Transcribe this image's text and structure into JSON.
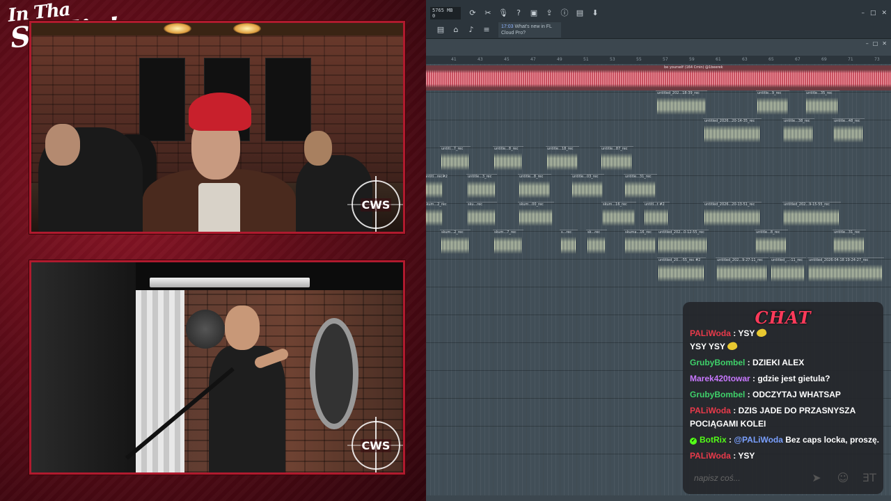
{
  "overlay": {
    "logo_line1": "In Tha",
    "logo_line2": "Studio!",
    "cam_top_watermark": "CWS",
    "cam_bottom_watermark": "CWS"
  },
  "daw": {
    "memory": "5765 MB",
    "memory_sub": "0",
    "news_time": "17:03",
    "news_text": "What's new in FL Cloud Pro?",
    "ruler_numbers": [
      "41",
      "43",
      "45",
      "47",
      "49",
      "51",
      "53",
      "55",
      "57",
      "59",
      "61",
      "63",
      "65",
      "67",
      "69",
      "71",
      "73"
    ],
    "master_clip_label": "be yourself (164 Cmin) @1beerek",
    "clips": [
      {
        "label": "untitled_202...18-39_rec"
      },
      {
        "label": "untitle...9_rec"
      },
      {
        "label": "untitle...35_rec"
      },
      {
        "label": "untitled_2026...20-14-35_rec"
      },
      {
        "label": "untitle...38_rec"
      },
      {
        "label": "untitle...48_rec"
      },
      {
        "label": "untitl...7_rec"
      },
      {
        "label": "untitle...8_rec"
      },
      {
        "label": "untitle...18_rec"
      },
      {
        "label": "untitle...87_rec"
      },
      {
        "label": "untitl...rec#2"
      },
      {
        "label": "untitle...3_rec"
      },
      {
        "label": "untitle...8_rec"
      },
      {
        "label": "untitle...03_rec"
      },
      {
        "label": "untitle...31_rec"
      },
      {
        "label": "skum...2_rec"
      },
      {
        "label": "sku...rec"
      },
      {
        "label": "skum...00_rec"
      },
      {
        "label": "skum...16_rec"
      },
      {
        "label": "untitl...t #2"
      },
      {
        "label": "untitled_2026...20-13-51_rec"
      },
      {
        "label": "untitled_202...9-15-55_rec"
      },
      {
        "label": "skum...2_rec"
      },
      {
        "label": "skum...7_rec"
      },
      {
        "label": "s...rec"
      },
      {
        "label": "sk...rec"
      },
      {
        "label": "skuma...16_rec"
      },
      {
        "label": "untitled_202...0-12-55_rec"
      },
      {
        "label": "untitle...8_rec"
      },
      {
        "label": "untitle...31_rec"
      },
      {
        "label": "untitled_20...-55_rec #2"
      },
      {
        "label": "untitled_202...9-27-11_rec"
      },
      {
        "label": "untitled_...-11_rec"
      },
      {
        "label": "untitled_2026-04-18 19-24-27_rec"
      }
    ]
  },
  "chat": {
    "title": "CHAT",
    "placeholder": "napisz coś...",
    "messages": [
      {
        "user": "PALiWoda",
        "color": "#e83a4a",
        "text": "YSY",
        "emotes": true,
        "line2": "YSY YSY"
      },
      {
        "user": "GrubyBombel",
        "color": "#3fd16a",
        "text": "DZIEKI ALEX"
      },
      {
        "user": "Marek420towar",
        "color": "#c878ff",
        "text": "gdzie jest gietula?"
      },
      {
        "user": "GrubyBombel",
        "color": "#3fd16a",
        "text": "ODCZYTAJ WHATSAP"
      },
      {
        "user": "PALiWoda",
        "color": "#e83a4a",
        "text": "DZIS JADE DO PRZASNYSZA POCIĄGAMI KOLEI"
      },
      {
        "user": "BotRix",
        "color": "#53fc18",
        "mention": "@PALiWoda",
        "text": "Bez caps locka, proszę."
      },
      {
        "user": "PALiWoda",
        "color": "#e83a4a",
        "text": "YSY"
      }
    ]
  }
}
